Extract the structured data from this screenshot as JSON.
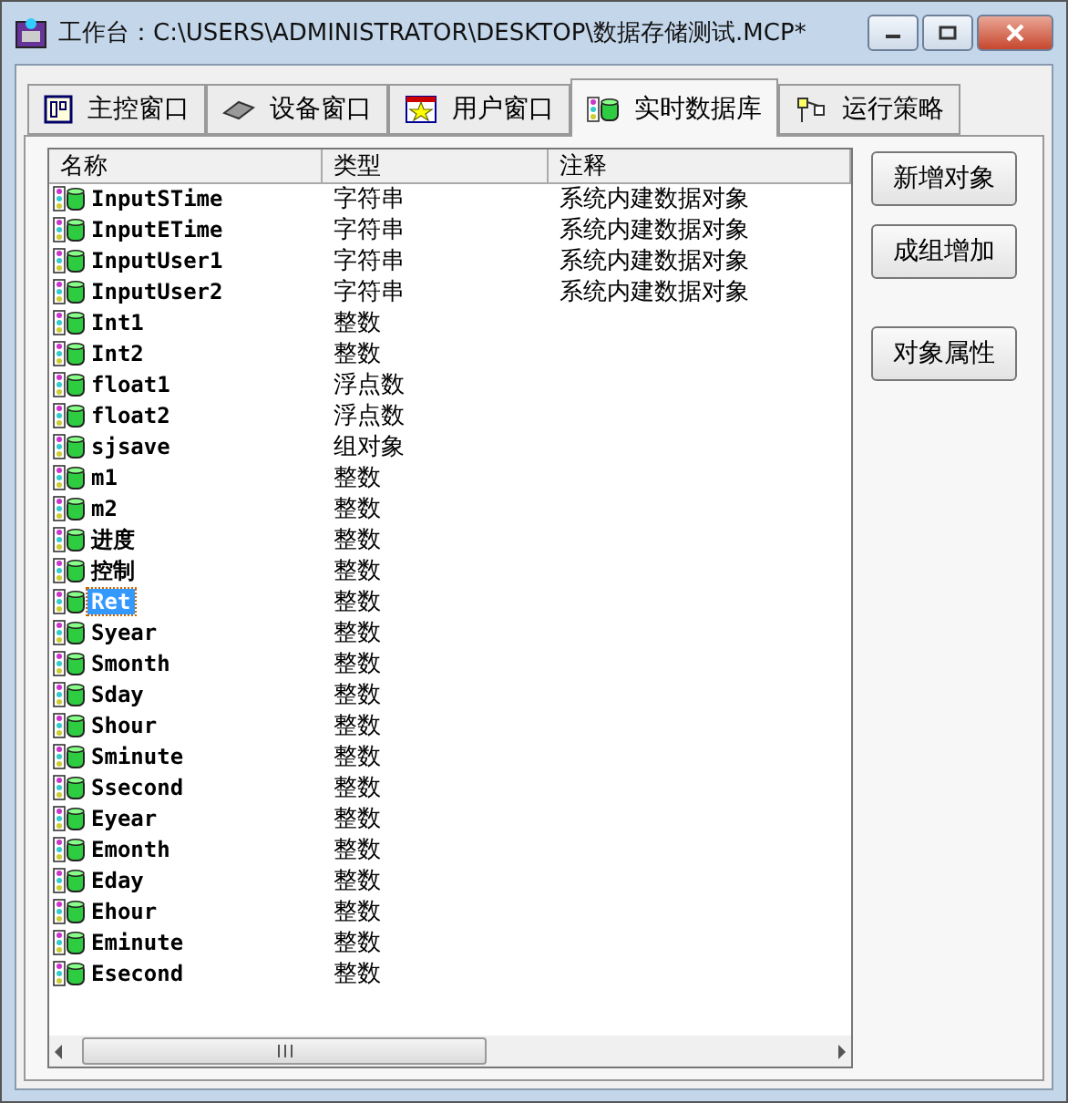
{
  "window": {
    "title": "工作台：C:\\USERS\\ADMINISTRATOR\\DESKTOP\\数据存储测试.MCP*"
  },
  "tabs": [
    {
      "label": "主控窗口",
      "kind": "main",
      "selected": false
    },
    {
      "label": "设备窗口",
      "kind": "device",
      "selected": false
    },
    {
      "label": "用户窗口",
      "kind": "user",
      "selected": false
    },
    {
      "label": "实时数据库",
      "kind": "database",
      "selected": true
    },
    {
      "label": "运行策略",
      "kind": "strategy",
      "selected": false
    }
  ],
  "table": {
    "columns": [
      "名称",
      "类型",
      "注释"
    ],
    "rows": [
      {
        "name": "InputSTime",
        "type": "字符串",
        "note": "系统内建数据对象",
        "selected": false
      },
      {
        "name": "InputETime",
        "type": "字符串",
        "note": "系统内建数据对象",
        "selected": false
      },
      {
        "name": "InputUser1",
        "type": "字符串",
        "note": "系统内建数据对象",
        "selected": false
      },
      {
        "name": "InputUser2",
        "type": "字符串",
        "note": "系统内建数据对象",
        "selected": false
      },
      {
        "name": "Int1",
        "type": "整数",
        "selected": false
      },
      {
        "name": "Int2",
        "type": "整数",
        "selected": false
      },
      {
        "name": "float1",
        "type": "浮点数",
        "selected": false
      },
      {
        "name": "float2",
        "type": "浮点数",
        "selected": false
      },
      {
        "name": "sjsave",
        "type": "组对象",
        "selected": false
      },
      {
        "name": "m1",
        "type": "整数",
        "selected": false
      },
      {
        "name": "m2",
        "type": "整数",
        "selected": false
      },
      {
        "name": "进度",
        "type": "整数",
        "selected": false
      },
      {
        "name": "控制",
        "type": "整数",
        "selected": false
      },
      {
        "name": "Ret",
        "type": "整数",
        "selected": true
      },
      {
        "name": "Syear",
        "type": "整数",
        "selected": false
      },
      {
        "name": "Smonth",
        "type": "整数",
        "selected": false
      },
      {
        "name": "Sday",
        "type": "整数",
        "selected": false
      },
      {
        "name": "Shour",
        "type": "整数",
        "selected": false
      },
      {
        "name": "Sminute",
        "type": "整数",
        "selected": false
      },
      {
        "name": "Ssecond",
        "type": "整数",
        "selected": false
      },
      {
        "name": "Eyear",
        "type": "整数",
        "selected": false
      },
      {
        "name": "Emonth",
        "type": "整数",
        "selected": false
      },
      {
        "name": "Eday",
        "type": "整数",
        "selected": false
      },
      {
        "name": "Ehour",
        "type": "整数",
        "selected": false
      },
      {
        "name": "Eminute",
        "type": "整数",
        "selected": false
      },
      {
        "name": "Esecond",
        "type": "整数",
        "selected": false
      }
    ]
  },
  "buttons": [
    "新增对象",
    "成组增加",
    "对象属性"
  ]
}
